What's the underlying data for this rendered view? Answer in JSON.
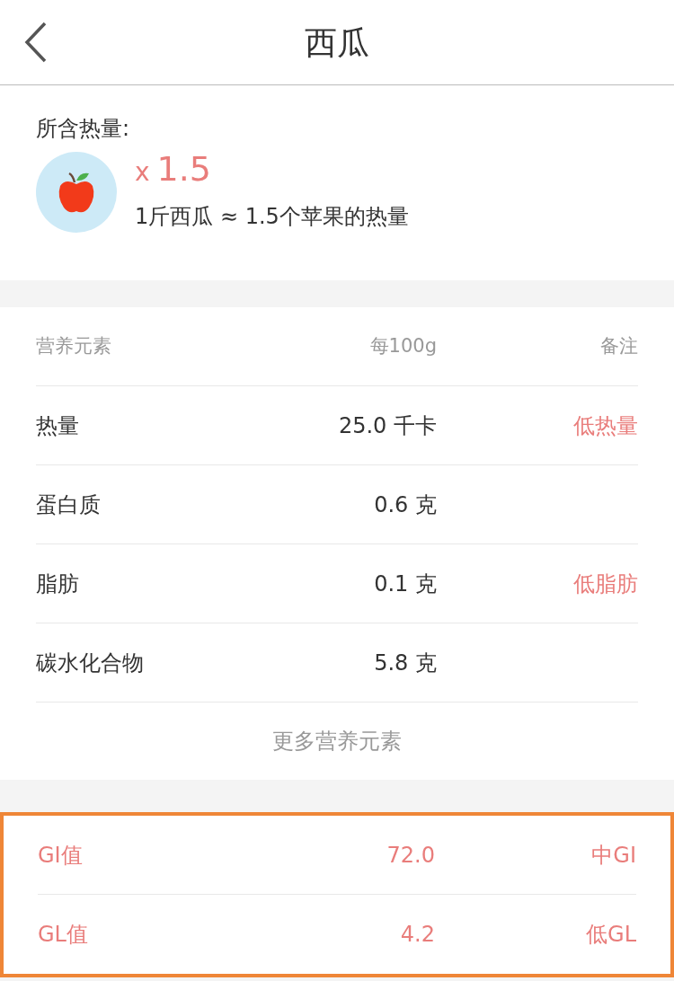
{
  "header": {
    "title": "西瓜"
  },
  "calories": {
    "label": "所含热量:",
    "multiplier_sign": "x",
    "multiplier": "1.5",
    "comparison": "1斤西瓜 ≈ 1.5个苹果的热量"
  },
  "nutrition_table": {
    "columns": [
      "营养元素",
      "每100g",
      "备注"
    ],
    "rows": [
      {
        "name": "热量",
        "value": "25.0 千卡",
        "note": "低热量"
      },
      {
        "name": "蛋白质",
        "value": "0.6 克"
      },
      {
        "name": "脂肪",
        "value": "0.1 克",
        "note": "低脂肪"
      },
      {
        "name": "碳水化合物",
        "value": "5.8 克"
      }
    ],
    "more_link": "更多营养元素"
  },
  "glycemic": {
    "highlighted": true,
    "rows": [
      {
        "name": "GI值",
        "value": "72.0",
        "note": "中GI"
      },
      {
        "name": "GL值",
        "value": "4.2",
        "note": "低GL"
      }
    ]
  }
}
